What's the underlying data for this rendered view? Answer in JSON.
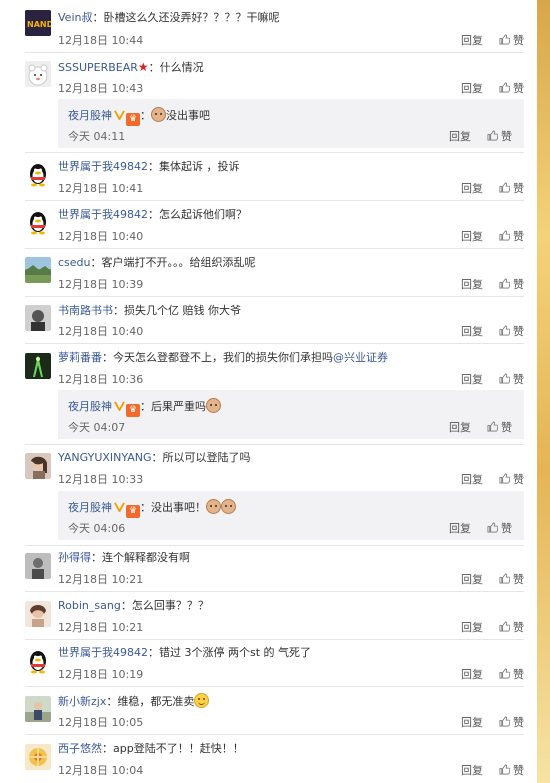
{
  "actions": {
    "reply": "回复",
    "like": "赞"
  },
  "colors": {
    "username": "#3b5998",
    "nested_bg": "#f2f2f5"
  },
  "comments": [
    {
      "user": "Vein叔",
      "text": "：卧槽这么久还没弄好？？？？干嘛呢",
      "date": "12月18日 10:44",
      "avatar": "logo-avatar"
    },
    {
      "user": "SSSUPERBEAR",
      "text": "：什么情况",
      "date": "12月18日 10:43",
      "avatar": "bear-avatar",
      "reply": {
        "user": "夜月股神",
        "text": "：",
        "text2": "没出事吧",
        "date": "今天 04:11"
      }
    },
    {
      "user": "世界属于我49842",
      "text": "：集体起诉 ，投诉",
      "date": "12月18日 10:41",
      "avatar": "penguin-avatar"
    },
    {
      "user": "世界属于我49842",
      "text": "：怎么起诉他们啊？",
      "date": "12月18日 10:40",
      "avatar": "penguin-avatar"
    },
    {
      "user": "csedu",
      "text": "：客户端打不开。。。给组织添乱呢",
      "date": "12月18日 10:39",
      "avatar": "landscape-avatar"
    },
    {
      "user": "书南路书书",
      "text": "：损失几个亿 赔钱 你大爷",
      "date": "12月18日 10:40",
      "avatar": "photo-avatar"
    },
    {
      "user": "萝莉番番",
      "text": "：今天怎么登都登不上，我们的损失你们承担吗",
      "link": "@兴业证券",
      "date": "12月18日 10:36",
      "avatar": "light-avatar",
      "reply": {
        "user": "夜月股神",
        "text": "：后果严重吗",
        "date": "今天 04:07"
      }
    },
    {
      "user": "YANGYUXINYANG",
      "text": "：所以可以登陆了吗",
      "date": "12月18日 10:33",
      "avatar": "girl-avatar",
      "reply": {
        "user": "夜月股神",
        "text": "：没出事吧！",
        "date": "今天 04:06"
      }
    },
    {
      "user": "孙得得",
      "text": "：连个解释都没有啊",
      "date": "12月18日 10:21",
      "avatar": "bw-avatar"
    },
    {
      "user": "Robin_sang",
      "text": "：怎么回事？？？",
      "date": "12月18日 10:21",
      "avatar": "woman-avatar"
    },
    {
      "user": "世界属于我49842",
      "text": "：错过 3个涨停 两个st  的 气死了",
      "date": "12月18日 10:19",
      "avatar": "penguin-avatar"
    },
    {
      "user": "新小新zjx",
      "text": "：维稳，都无准卖",
      "date": "12月18日 10:05",
      "avatar": "scene-avatar"
    },
    {
      "user": "西子悠然",
      "text": "：app登陆不了！！赶快！！",
      "date": "12月18日 10:04",
      "avatar": "flower-avatar"
    }
  ]
}
